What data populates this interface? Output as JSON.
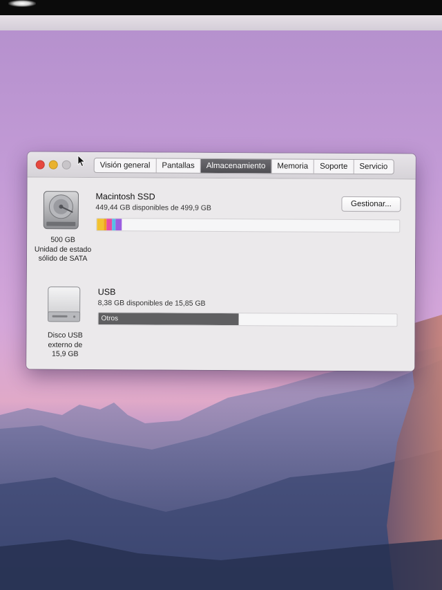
{
  "tabs": [
    {
      "label": "Visión general",
      "active": false
    },
    {
      "label": "Pantallas",
      "active": false
    },
    {
      "label": "Almacenamiento",
      "active": true
    },
    {
      "label": "Memoria",
      "active": false
    },
    {
      "label": "Soporte",
      "active": false
    },
    {
      "label": "Servicio",
      "active": false
    }
  ],
  "drives": [
    {
      "icon": "hard-drive-icon",
      "capacity": "500 GB",
      "type_line1": "Unidad de estado",
      "type_line2": "sólido de SATA",
      "name": "Macintosh SSD",
      "available": "449,44 GB disponibles de 499,9 GB",
      "button": "Gestionar...",
      "usage_segments": [
        {
          "color": "#f2c230",
          "fraction": 0.022
        },
        {
          "color": "#f0a020",
          "fraction": 0.01
        },
        {
          "color": "#e94ca2",
          "fraction": 0.018
        },
        {
          "color": "#55c0e6",
          "fraction": 0.012
        },
        {
          "color": "#9b5ee0",
          "fraction": 0.02
        }
      ]
    },
    {
      "icon": "usb-drive-icon",
      "type_line1": "Disco USB",
      "type_line2": "externo de",
      "capacity": "15,9 GB",
      "name": "USB",
      "available": "8,38 GB disponibles de 15,85 GB",
      "usage_label": "Otros",
      "usage_fraction": 0.471,
      "usage_color": "#5f5f61"
    }
  ]
}
